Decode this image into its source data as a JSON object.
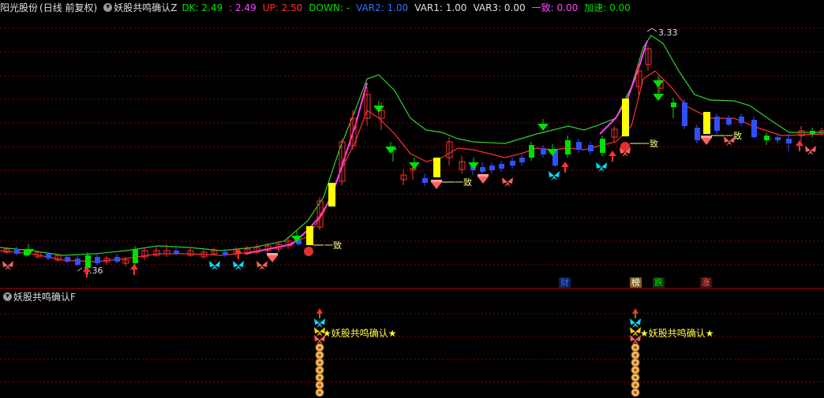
{
  "header": {
    "stock": "阳光股份",
    "period": "(日线 前复权)",
    "indicator": "妖股共鸣确认Z",
    "values": [
      {
        "label": "DK: 2.49",
        "color": "#00e000"
      },
      {
        "label": ": 2.49",
        "color": "#ff44ff"
      },
      {
        "label": "UP: 2.50",
        "color": "#ff3030"
      },
      {
        "label": "DOWN: -",
        "color": "#00e000"
      },
      {
        "label": "VAR2: 1.00",
        "color": "#3070ff"
      },
      {
        "label": "VAR1: 1.00",
        "color": "#e0e0e0"
      },
      {
        "label": "VAR3: 0.00",
        "color": "#e0e0e0"
      },
      {
        "label": "一致: 0.00",
        "color": "#ff44ff"
      },
      {
        "label": "加速: 0.00",
        "color": "#00e000"
      }
    ]
  },
  "sub_header": {
    "indicator": "妖股共鸣确认F"
  },
  "annotations": {
    "high_price": "3.33",
    "low_price": "1.36",
    "yizhi_labels": [
      "一致",
      "一致",
      "一致",
      "一致",
      "一致"
    ],
    "signal_text": "★妖股共鸣确认★"
  },
  "badges": [
    {
      "text": "财",
      "color": "#3070ff",
      "bg": "#102050"
    },
    {
      "text": "榜",
      "color": "#ffffff",
      "bg": "#806020"
    },
    {
      "text": "跌",
      "color": "#00e000",
      "bg": "#103010"
    },
    {
      "text": "涨",
      "color": "#ff6060",
      "bg": "#401010"
    }
  ],
  "colors": {
    "up": "#ff3030",
    "down": "#00e0ff",
    "blue": "#3050ff",
    "yellow": "#ffff00",
    "magenta": "#ff40ff",
    "green": "#00e000",
    "grid": "#a00000"
  },
  "icons": [
    "butterfly-icon",
    "diamond-icon",
    "arrow-up-icon",
    "arrow-down-icon",
    "coin-icon",
    "duo-icon"
  ]
}
